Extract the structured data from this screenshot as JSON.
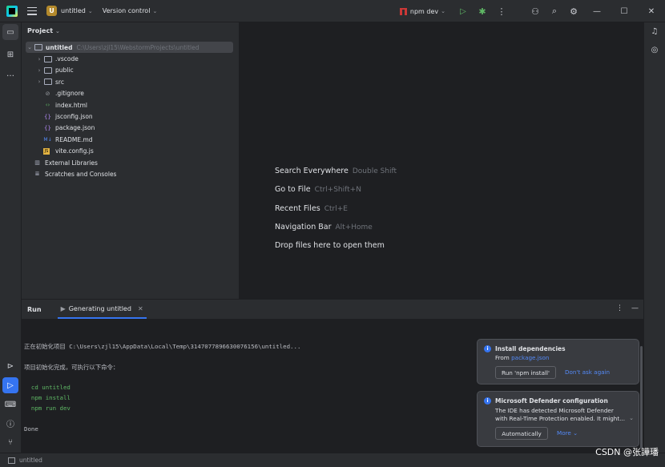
{
  "titlebar": {
    "project_badge": "U",
    "project_name": "untitled",
    "version_control": "Version control",
    "run_config": "npm dev"
  },
  "project_panel": {
    "title": "Project",
    "root": {
      "name": "untitled",
      "path": "C:\\Users\\zjl15\\WebstormProjects\\untitled"
    },
    "items": [
      {
        "label": ".vscode",
        "type": "folder"
      },
      {
        "label": "public",
        "type": "folder"
      },
      {
        "label": "src",
        "type": "folder"
      },
      {
        "label": ".gitignore",
        "type": "gitignore"
      },
      {
        "label": "index.html",
        "type": "html"
      },
      {
        "label": "jsconfig.json",
        "type": "json"
      },
      {
        "label": "package.json",
        "type": "json"
      },
      {
        "label": "README.md",
        "type": "markdown",
        "icon_text": "M↓"
      },
      {
        "label": "vite.config.js",
        "type": "js"
      }
    ],
    "external_libraries": "External Libraries",
    "scratches": "Scratches and Consoles"
  },
  "editor": {
    "tips": [
      {
        "label": "Search Everywhere",
        "shortcut": "Double Shift"
      },
      {
        "label": "Go to File",
        "shortcut": "Ctrl+Shift+N"
      },
      {
        "label": "Recent Files",
        "shortcut": "Ctrl+E"
      },
      {
        "label": "Navigation Bar",
        "shortcut": "Alt+Home"
      },
      {
        "label": "Drop files here to open them",
        "shortcut": ""
      }
    ]
  },
  "run_panel": {
    "title": "Run",
    "tab_label": "Generating untitled",
    "console": {
      "line1_prefix": "正在初始化项目 ",
      "line1_path": "C:\\Users\\zjl15\\AppData\\Local\\Temp\\3147077896630076156\\untitled...",
      "line2": "项目初始化完成，可执行以下命令：",
      "cmd1": "  cd untitled",
      "cmd2": "  npm install",
      "cmd3": "  npm run dev",
      "done": "Done"
    }
  },
  "notifications": {
    "install": {
      "title": "Install dependencies",
      "from_label": "From",
      "from_link": "package.json",
      "button": "Run 'npm install'",
      "dismiss": "Don't ask again"
    },
    "defender": {
      "title": "Microsoft Defender configuration",
      "body1": "The IDE has detected Microsoft Defender",
      "body2": "with Real-Time Protection enabled. It might...",
      "button": "Automatically",
      "more": "More"
    }
  },
  "statusbar": {
    "project": "untitled"
  },
  "watermark": "CSDN @张譁璠",
  "icons": {
    "bell": "bell-icon",
    "ai": "ai-assistant-icon"
  },
  "colors": {
    "accent": "#3574f0",
    "green": "#5fb865",
    "link": "#548af7"
  }
}
